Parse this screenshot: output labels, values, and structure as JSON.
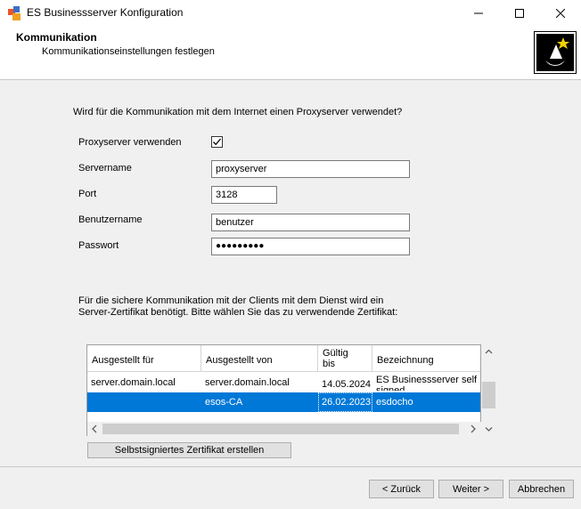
{
  "window": {
    "title": "ES Businessserver Konfiguration"
  },
  "header": {
    "title": "Kommunikation",
    "subtitle": "Kommunikationseinstellungen festlegen"
  },
  "proxy": {
    "question": "Wird für die Kommunikation mit dem Internet einen Proxyserver verwendet?",
    "use_label": "Proxyserver verwenden",
    "use_checked": true,
    "server_label": "Servername",
    "server_value": "proxyserver",
    "port_label": "Port",
    "port_value": "3128",
    "user_label": "Benutzername",
    "user_value": "benutzer",
    "password_label": "Passwort",
    "password_value": "●●●●●●●●●"
  },
  "cert": {
    "info_line1": "Für die sichere Kommunikation mit der Clients mit dem Dienst wird ein",
    "info_line2": "Server-Zertifikat benötigt. Bitte wählen Sie das zu verwendende Zertifikat:",
    "columns": [
      "Ausgestellt für",
      "Ausgestellt von",
      "Gültig bis",
      "Bezeichnung"
    ],
    "rows": [
      {
        "issued_to": "server.domain.local",
        "issued_by": "server.domain.local",
        "valid_until": "14.05.2024",
        "name": "ES Businessserver self signed",
        "selected": false
      },
      {
        "issued_to": "",
        "issued_by": "esos-CA",
        "valid_until": "26.02.2023",
        "name": "esdocho",
        "selected": true
      }
    ],
    "create_button": "Selbstsigniertes Zertifikat erstellen"
  },
  "footer": {
    "back": "< Zurück",
    "next": "Weiter >",
    "cancel": "Abbrechen"
  },
  "colors": {
    "selection": "#0078d7",
    "background": "#f0f0f0"
  }
}
